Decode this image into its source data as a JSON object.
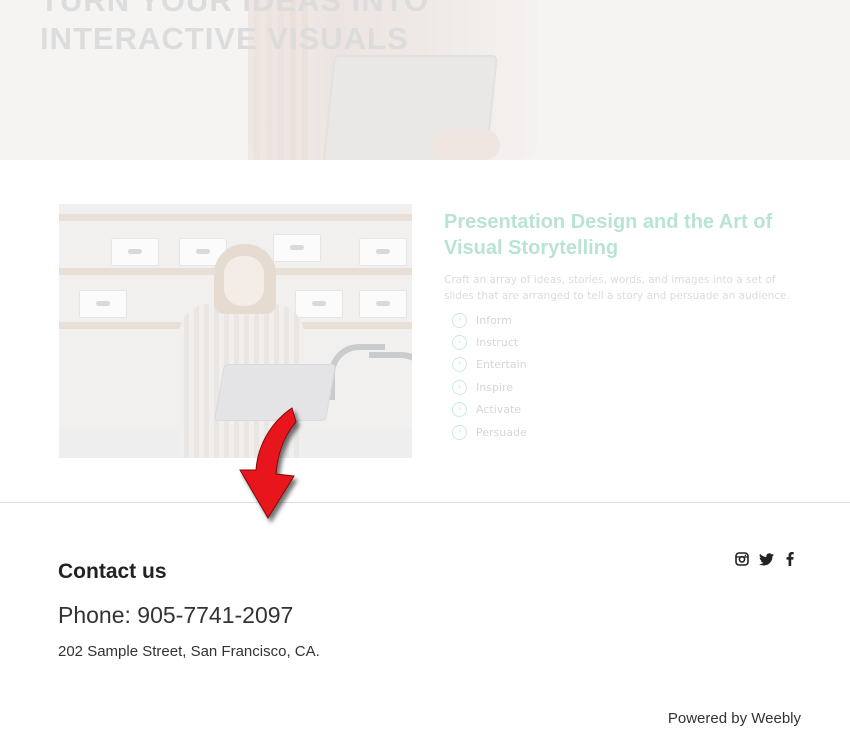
{
  "hero": {
    "title_line1": "TURN YOUR IDEAS INTO",
    "title_line2": "INTERACTIVE VISUALS"
  },
  "feature": {
    "heading": "Presentation Design and the Art of Visual Storytelling",
    "text": "Craft an array of ideas, stories, words, and images into a set of slides that are arranged to tell a story and persuade an audience.",
    "items": [
      {
        "label": "Inform",
        "icon": "chevron-right-circle-icon"
      },
      {
        "label": "Instruct",
        "icon": "chevron-right-circle-icon"
      },
      {
        "label": "Entertain",
        "icon": "chevron-right-circle-icon"
      },
      {
        "label": "Inspire",
        "icon": "chevron-right-circle-icon"
      },
      {
        "label": "Activate",
        "icon": "chevron-right-circle-icon"
      },
      {
        "label": "Persuade",
        "icon": "chevron-right-circle-icon"
      }
    ],
    "accent_color": "#b9e3d5"
  },
  "annotation": {
    "icon": "red-curved-arrow-icon",
    "color": "#e8141c"
  },
  "footer": {
    "contact_title": "Contact us",
    "phone": "Phone: 905-7741-2097",
    "address": "202 Sample Street, San Francisco, CA.",
    "social": [
      {
        "name": "instagram",
        "icon": "instagram-icon"
      },
      {
        "name": "twitter",
        "icon": "twitter-icon"
      },
      {
        "name": "facebook",
        "icon": "facebook-icon"
      }
    ],
    "powered_by": "Powered by Weebly"
  }
}
